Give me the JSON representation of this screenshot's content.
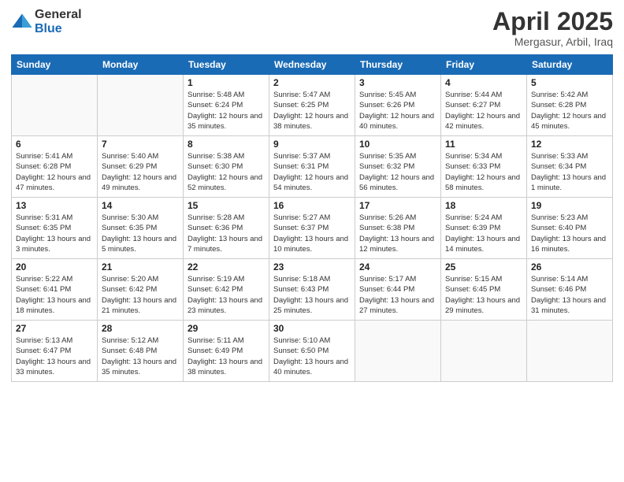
{
  "logo": {
    "general": "General",
    "blue": "Blue"
  },
  "title": "April 2025",
  "subtitle": "Mergasur, Arbil, Iraq",
  "days_of_week": [
    "Sunday",
    "Monday",
    "Tuesday",
    "Wednesday",
    "Thursday",
    "Friday",
    "Saturday"
  ],
  "weeks": [
    [
      {
        "day": "",
        "info": ""
      },
      {
        "day": "",
        "info": ""
      },
      {
        "day": "1",
        "info": "Sunrise: 5:48 AM\nSunset: 6:24 PM\nDaylight: 12 hours and 35 minutes."
      },
      {
        "day": "2",
        "info": "Sunrise: 5:47 AM\nSunset: 6:25 PM\nDaylight: 12 hours and 38 minutes."
      },
      {
        "day": "3",
        "info": "Sunrise: 5:45 AM\nSunset: 6:26 PM\nDaylight: 12 hours and 40 minutes."
      },
      {
        "day": "4",
        "info": "Sunrise: 5:44 AM\nSunset: 6:27 PM\nDaylight: 12 hours and 42 minutes."
      },
      {
        "day": "5",
        "info": "Sunrise: 5:42 AM\nSunset: 6:28 PM\nDaylight: 12 hours and 45 minutes."
      }
    ],
    [
      {
        "day": "6",
        "info": "Sunrise: 5:41 AM\nSunset: 6:28 PM\nDaylight: 12 hours and 47 minutes."
      },
      {
        "day": "7",
        "info": "Sunrise: 5:40 AM\nSunset: 6:29 PM\nDaylight: 12 hours and 49 minutes."
      },
      {
        "day": "8",
        "info": "Sunrise: 5:38 AM\nSunset: 6:30 PM\nDaylight: 12 hours and 52 minutes."
      },
      {
        "day": "9",
        "info": "Sunrise: 5:37 AM\nSunset: 6:31 PM\nDaylight: 12 hours and 54 minutes."
      },
      {
        "day": "10",
        "info": "Sunrise: 5:35 AM\nSunset: 6:32 PM\nDaylight: 12 hours and 56 minutes."
      },
      {
        "day": "11",
        "info": "Sunrise: 5:34 AM\nSunset: 6:33 PM\nDaylight: 12 hours and 58 minutes."
      },
      {
        "day": "12",
        "info": "Sunrise: 5:33 AM\nSunset: 6:34 PM\nDaylight: 13 hours and 1 minute."
      }
    ],
    [
      {
        "day": "13",
        "info": "Sunrise: 5:31 AM\nSunset: 6:35 PM\nDaylight: 13 hours and 3 minutes."
      },
      {
        "day": "14",
        "info": "Sunrise: 5:30 AM\nSunset: 6:35 PM\nDaylight: 13 hours and 5 minutes."
      },
      {
        "day": "15",
        "info": "Sunrise: 5:28 AM\nSunset: 6:36 PM\nDaylight: 13 hours and 7 minutes."
      },
      {
        "day": "16",
        "info": "Sunrise: 5:27 AM\nSunset: 6:37 PM\nDaylight: 13 hours and 10 minutes."
      },
      {
        "day": "17",
        "info": "Sunrise: 5:26 AM\nSunset: 6:38 PM\nDaylight: 13 hours and 12 minutes."
      },
      {
        "day": "18",
        "info": "Sunrise: 5:24 AM\nSunset: 6:39 PM\nDaylight: 13 hours and 14 minutes."
      },
      {
        "day": "19",
        "info": "Sunrise: 5:23 AM\nSunset: 6:40 PM\nDaylight: 13 hours and 16 minutes."
      }
    ],
    [
      {
        "day": "20",
        "info": "Sunrise: 5:22 AM\nSunset: 6:41 PM\nDaylight: 13 hours and 18 minutes."
      },
      {
        "day": "21",
        "info": "Sunrise: 5:20 AM\nSunset: 6:42 PM\nDaylight: 13 hours and 21 minutes."
      },
      {
        "day": "22",
        "info": "Sunrise: 5:19 AM\nSunset: 6:42 PM\nDaylight: 13 hours and 23 minutes."
      },
      {
        "day": "23",
        "info": "Sunrise: 5:18 AM\nSunset: 6:43 PM\nDaylight: 13 hours and 25 minutes."
      },
      {
        "day": "24",
        "info": "Sunrise: 5:17 AM\nSunset: 6:44 PM\nDaylight: 13 hours and 27 minutes."
      },
      {
        "day": "25",
        "info": "Sunrise: 5:15 AM\nSunset: 6:45 PM\nDaylight: 13 hours and 29 minutes."
      },
      {
        "day": "26",
        "info": "Sunrise: 5:14 AM\nSunset: 6:46 PM\nDaylight: 13 hours and 31 minutes."
      }
    ],
    [
      {
        "day": "27",
        "info": "Sunrise: 5:13 AM\nSunset: 6:47 PM\nDaylight: 13 hours and 33 minutes."
      },
      {
        "day": "28",
        "info": "Sunrise: 5:12 AM\nSunset: 6:48 PM\nDaylight: 13 hours and 35 minutes."
      },
      {
        "day": "29",
        "info": "Sunrise: 5:11 AM\nSunset: 6:49 PM\nDaylight: 13 hours and 38 minutes."
      },
      {
        "day": "30",
        "info": "Sunrise: 5:10 AM\nSunset: 6:50 PM\nDaylight: 13 hours and 40 minutes."
      },
      {
        "day": "",
        "info": ""
      },
      {
        "day": "",
        "info": ""
      },
      {
        "day": "",
        "info": ""
      }
    ]
  ]
}
